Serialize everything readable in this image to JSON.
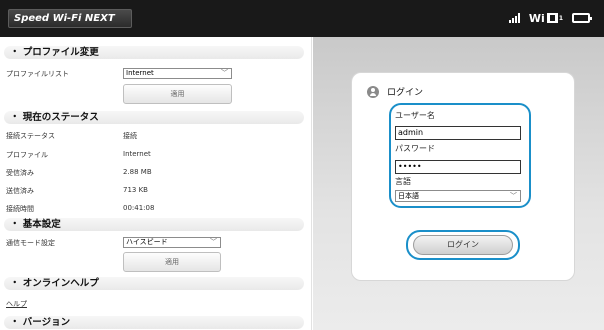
{
  "header": {
    "logo": "Speed Wi-Fi NEXT",
    "wifi_label": "Wi",
    "wifi_sub": "1",
    "icons": [
      "signal-icon",
      "wifi-icon",
      "battery-icon"
    ]
  },
  "sections": {
    "profile": {
      "title": "・ プロファイル変更",
      "list_label": "プロファイルリスト",
      "list_value": "Internet",
      "apply": "適用"
    },
    "status": {
      "title": "・ 現在のステータス",
      "rows": [
        {
          "label": "接続ステータス",
          "value": "接続"
        },
        {
          "label": "プロファイル",
          "value": "Internet"
        },
        {
          "label": "受信済み",
          "value": "2.88 MB"
        },
        {
          "label": "送信済み",
          "value": "713 KB"
        },
        {
          "label": "接続時間",
          "value": "00:41:08"
        }
      ]
    },
    "basic": {
      "title": "・ 基本設定",
      "mode_label": "通信モード設定",
      "mode_value": "ハイスピード",
      "apply": "適用"
    },
    "help": {
      "title": "・ オンラインヘルプ",
      "link": "ヘルプ"
    },
    "version": {
      "title": "・ バージョン"
    }
  },
  "login": {
    "title": "ログイン",
    "username_label": "ユーザー名",
    "username_value": "admin",
    "password_label": "パスワード",
    "password_value": "•••••",
    "language_label": "言語",
    "language_value": "日本語",
    "button": "ログイン"
  },
  "colors": {
    "topbar": "#191919",
    "accent": "#1a8fc9"
  }
}
